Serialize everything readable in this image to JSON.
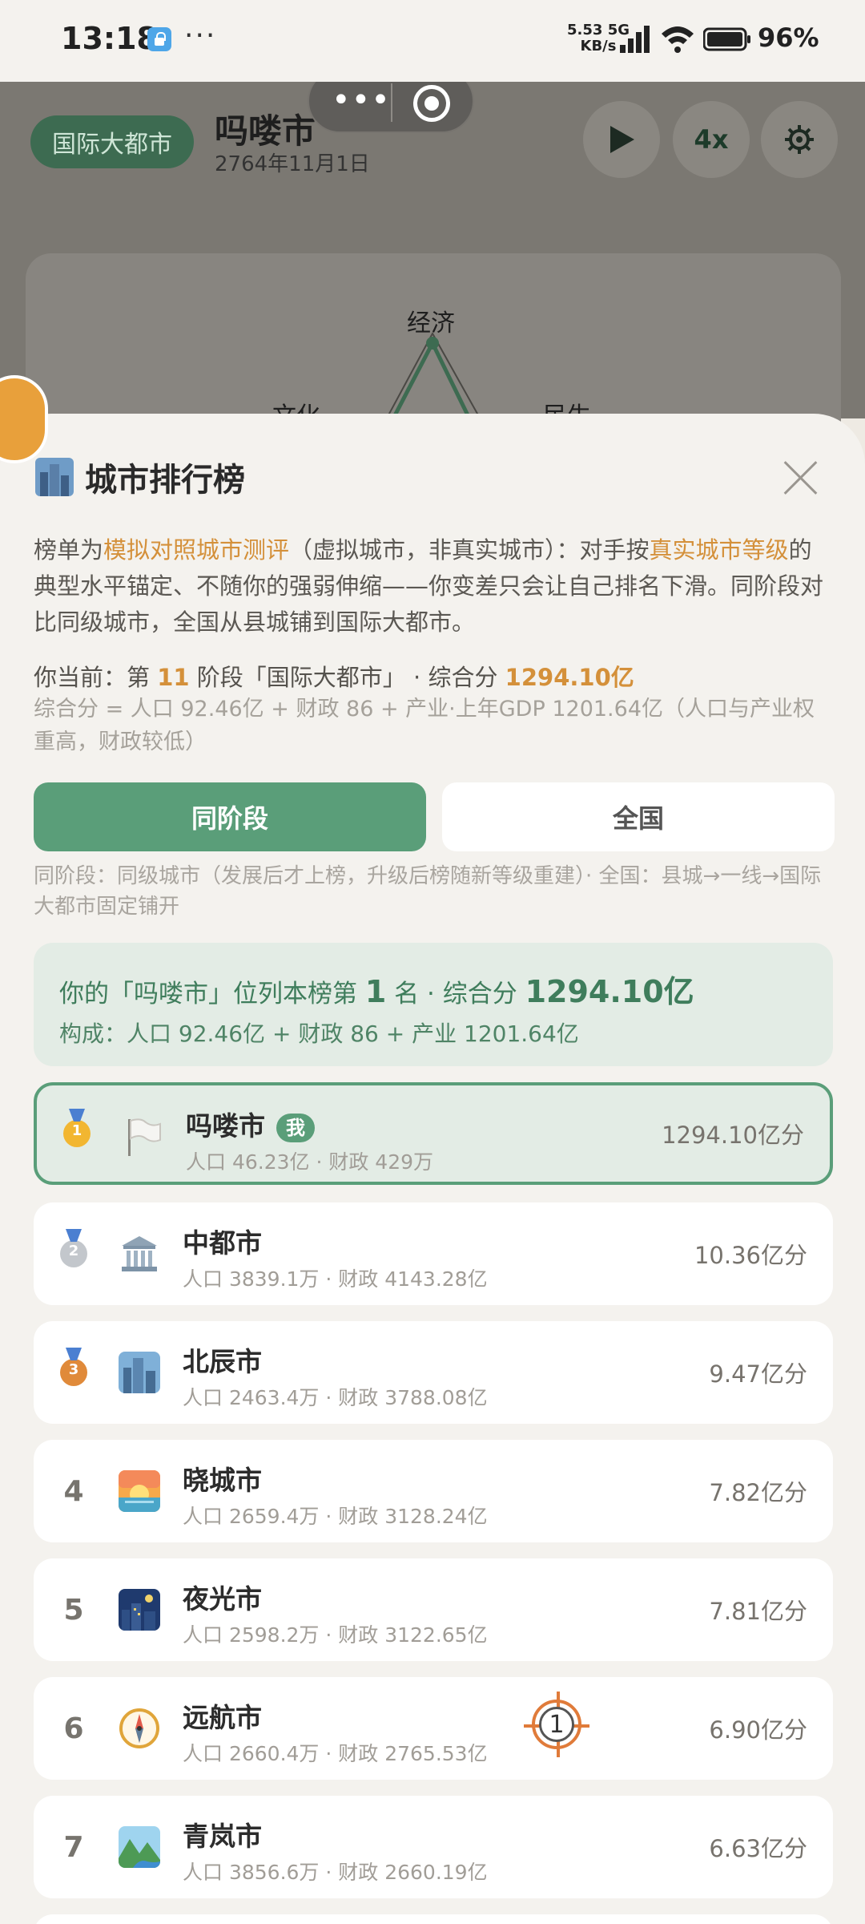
{
  "status_bar": {
    "time": "13:18",
    "speed_value": "5.53",
    "speed_unit": "KB/s",
    "network": "5G",
    "battery": "96%"
  },
  "background_app": {
    "badge": "国际大都市",
    "title": "吗喽市",
    "date": "2764年11月1日",
    "speed_label": "4x",
    "radar_labels": {
      "economy": "经济",
      "culture": "文化",
      "livelihood": "民生"
    }
  },
  "sheet": {
    "title": "城市排行榜",
    "intro": {
      "p1": "榜单为",
      "hl1": "模拟对照城市测评",
      "p2": "（虚拟城市，非真实城市）：对手按",
      "hl2": "真实城市等级",
      "p3": "的典型水平锚定、不随你的强弱伸缩——你变差只会让自己排名下滑。同阶段对比同级城市，全国从县城铺到国际大都市。"
    },
    "current": {
      "pre": "你当前：第 ",
      "stage": "11",
      "mid": " 阶段「国际大都市」 · 综合分 ",
      "score": "1294.10亿"
    },
    "formula": "综合分 = 人口 92.46亿 + 财政 86 + 产业·上年GDP 1201.64亿（人口与产业权重高，财政较低）",
    "tabs": {
      "same_stage": "同阶段",
      "national": "全国"
    },
    "tab_note": "同阶段：同级城市（发展后才上榜，升级后榜随新等级重建）· 全国：县城→一线→国际大都市固定铺开",
    "summary": {
      "pre": "你的「吗喽市」位列本榜第 ",
      "rank": "1",
      "mid": " 名 · 综合分 ",
      "score": "1294.10亿",
      "composition": "构成：人口 92.46亿 + 财政 86 + 产业 1201.64亿"
    },
    "me_badge": "我",
    "rows": [
      {
        "rank": "1",
        "name": "吗喽市",
        "sub": "人口 46.23亿 · 财政 429万",
        "score": "1294.10亿分",
        "icon": "white-flag-icon"
      },
      {
        "rank": "2",
        "name": "中都市",
        "sub": "人口 3839.1万 · 财政 4143.28亿",
        "score": "10.36亿分",
        "icon": "classical-building-icon"
      },
      {
        "rank": "3",
        "name": "北辰市",
        "sub": "人口 2463.4万 · 财政 3788.08亿",
        "score": "9.47亿分",
        "icon": "cityscape-icon"
      },
      {
        "rank": "4",
        "name": "晓城市",
        "sub": "人口 2659.4万 · 财政 3128.24亿",
        "score": "7.82亿分",
        "icon": "sunrise-icon"
      },
      {
        "rank": "5",
        "name": "夜光市",
        "sub": "人口 2598.2万 · 财政 3122.65亿",
        "score": "7.81亿分",
        "icon": "night-city-icon"
      },
      {
        "rank": "6",
        "name": "远航市",
        "sub": "人口 2660.4万 · 财政 2765.53亿",
        "score": "6.90亿分",
        "icon": "compass-icon"
      },
      {
        "rank": "7",
        "name": "青岚市",
        "sub": "人口 3856.6万 · 财政 2660.19亿",
        "score": "6.63亿分",
        "icon": "mountain-river-icon"
      }
    ],
    "floating_marker": "1"
  }
}
